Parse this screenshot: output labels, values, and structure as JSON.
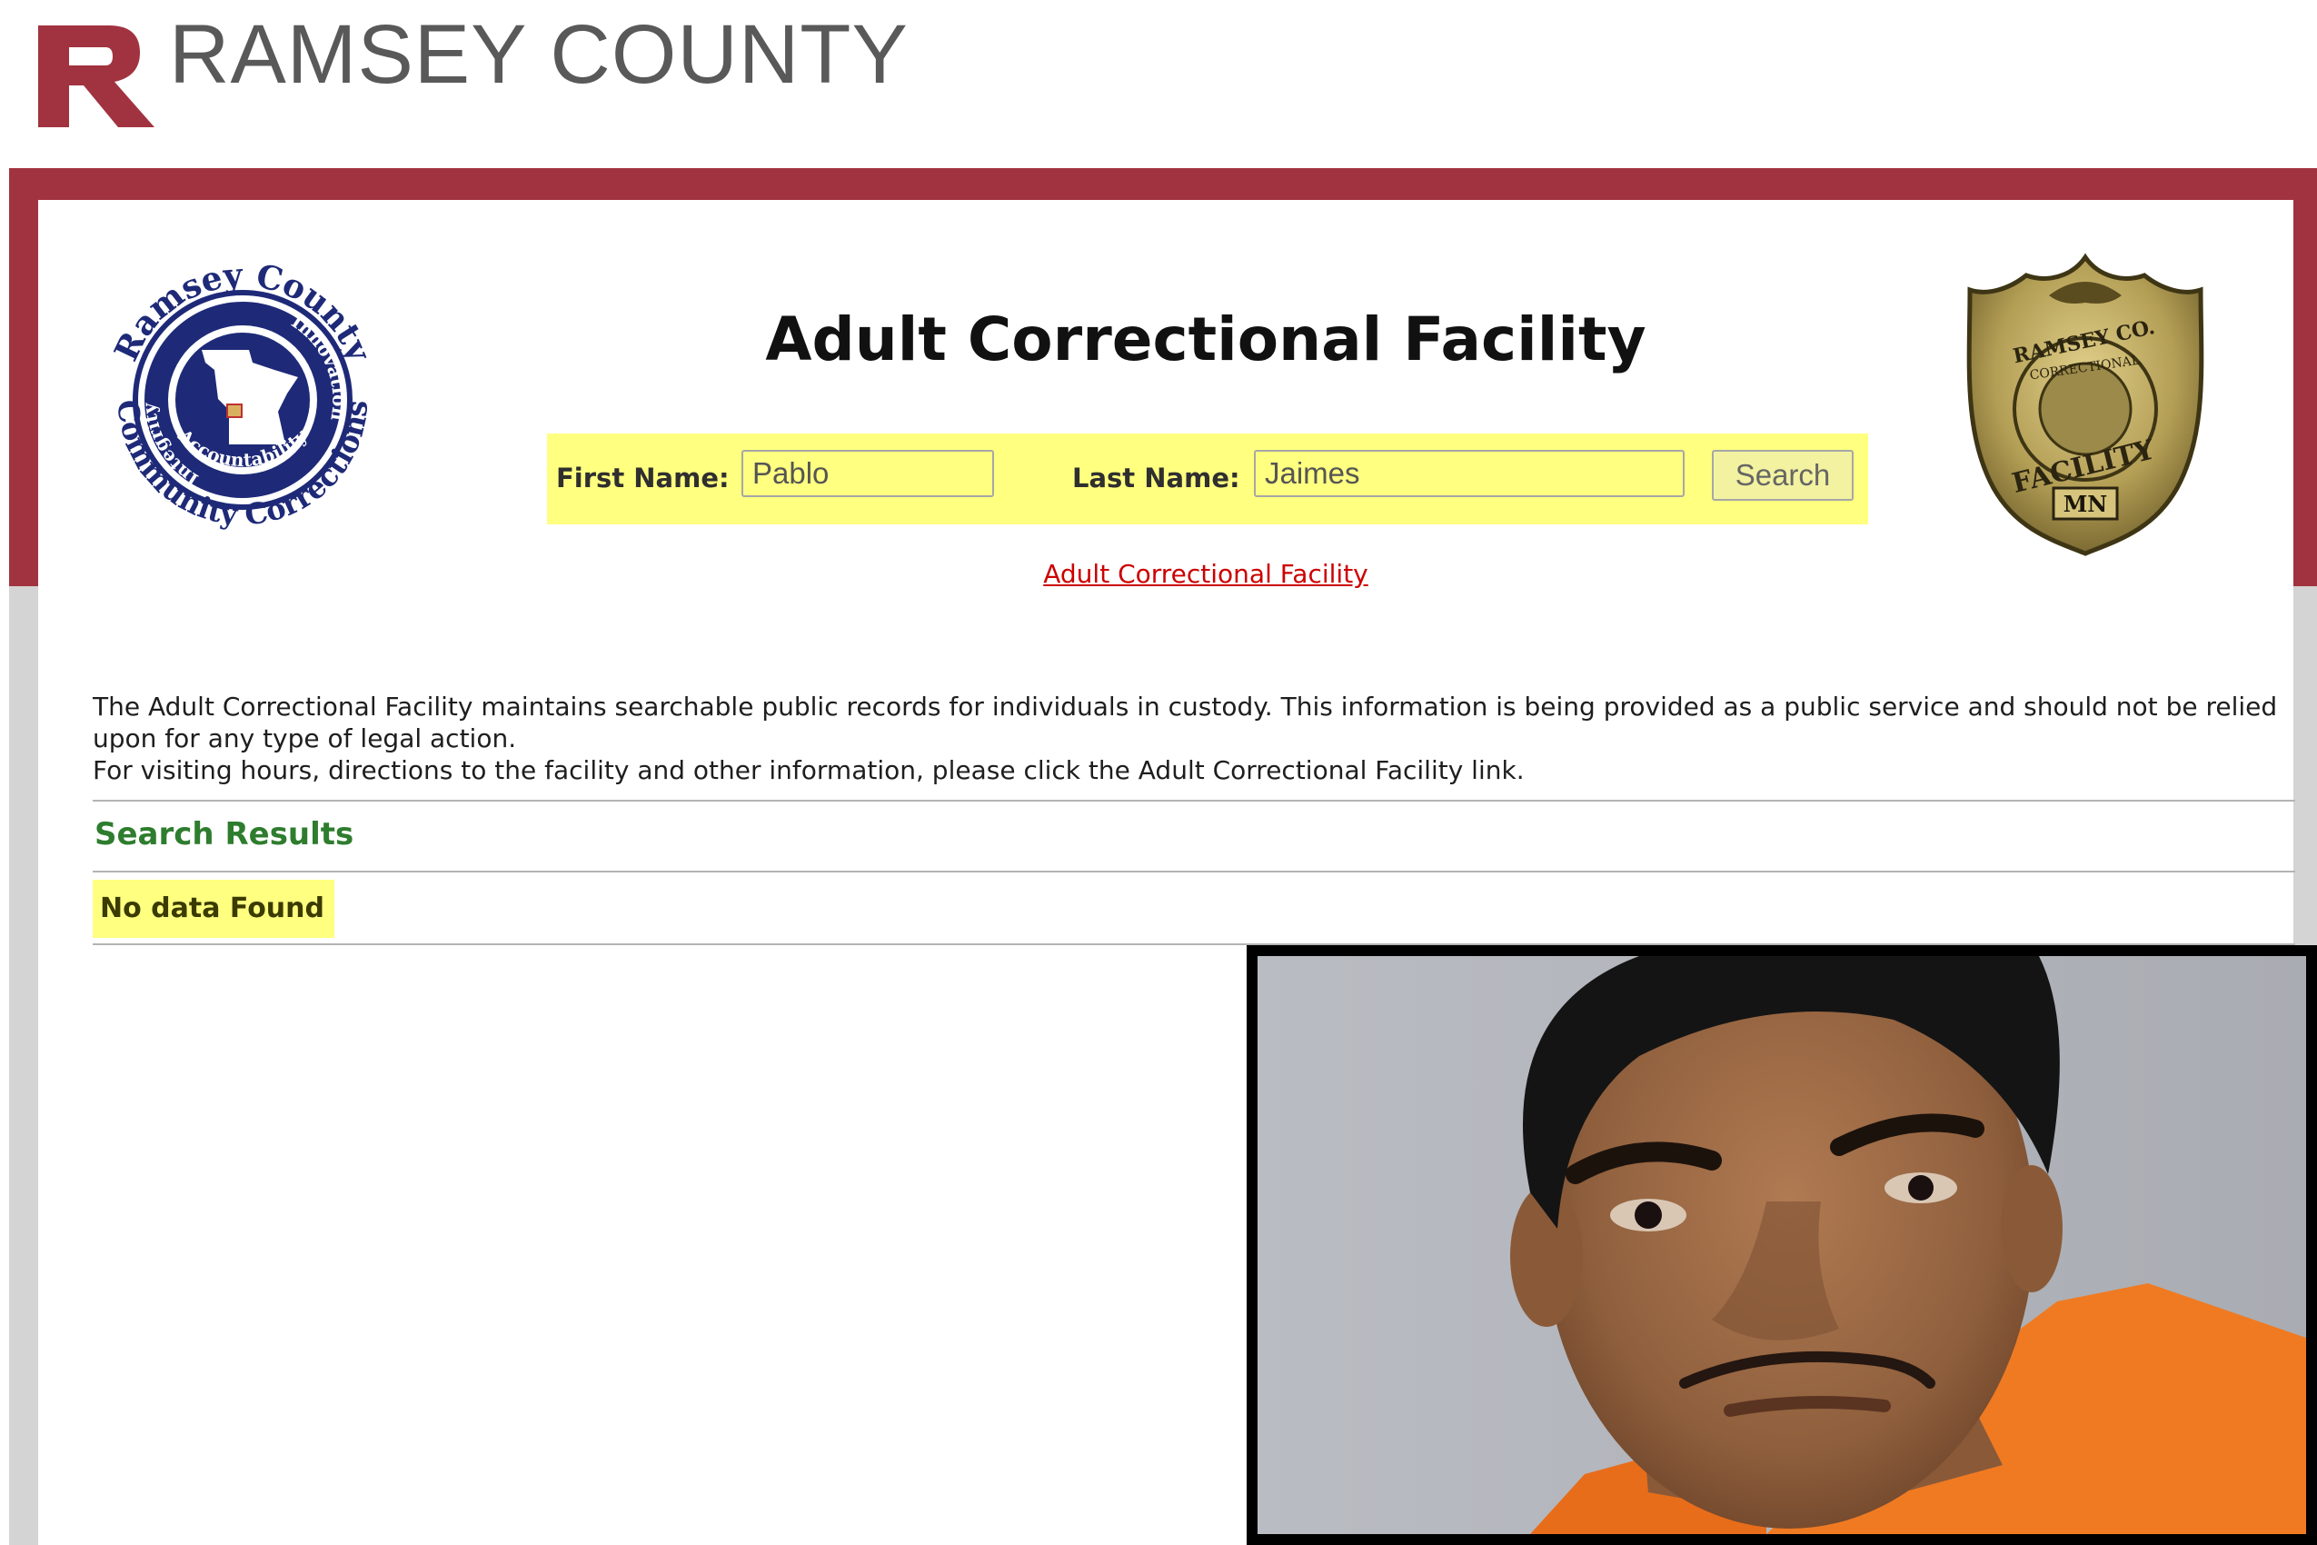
{
  "header": {
    "brand_text": "RAMSEY COUNTY",
    "brand_color": "#a13340"
  },
  "seal": {
    "ring_top": "Ramsey County",
    "ring_bottom": "Community Corrections",
    "inner_left": "Integrity",
    "inner_right": "Innovation",
    "inner_bottom": "Accountability"
  },
  "badge": {
    "line1": "RAMSEY CO.",
    "line2": "CORRECTIONAL",
    "line3": "FACILITY",
    "state": "MN"
  },
  "page": {
    "title": "Adult Correctional Facility"
  },
  "search": {
    "first_name_label": "First Name:",
    "first_name_value": "Pablo",
    "last_name_label": "Last Name:",
    "last_name_value": "Jaimes",
    "button_label": "Search",
    "highlight_color": "#ffff80"
  },
  "links": {
    "facility": "Adult Correctional Facility"
  },
  "info": {
    "paragraph1": "The Adult Correctional Facility maintains searchable public records for individuals in custody. This information is being provided as a public service and should not be relied upon for any type of legal action.",
    "paragraph2": "For visiting hours, directions to the facility and other information, please click the Adult Correctional Facility link."
  },
  "results": {
    "heading": "Search Results",
    "heading_color": "#2e7d2e",
    "message": "No data Found"
  }
}
